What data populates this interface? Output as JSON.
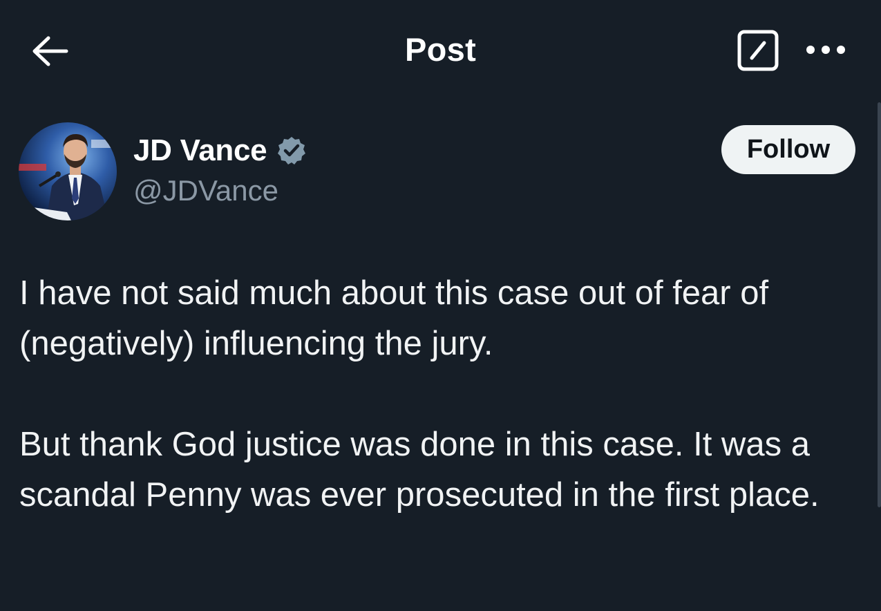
{
  "header": {
    "title": "Post",
    "back_icon": "arrow-left-icon",
    "grok_icon": "grok-icon",
    "more_icon": "more-horizontal-icon"
  },
  "author": {
    "name": "JD Vance",
    "handle": "@JDVance",
    "verified_icon": "verified-badge-icon",
    "verified_color": "#829aab"
  },
  "follow_button": {
    "label": "Follow"
  },
  "post": {
    "paragraphs": [
      "I have not said much about this case out of fear of (negatively) influencing the jury.",
      "But thank God justice was done in this case. It was a scandal Penny was ever prosecuted in the first place."
    ]
  },
  "colors": {
    "background": "#161e27",
    "text_primary": "#ffffff",
    "text_secondary": "#8b98a5",
    "button_bg": "#eff3f4",
    "button_text": "#0f1419"
  }
}
